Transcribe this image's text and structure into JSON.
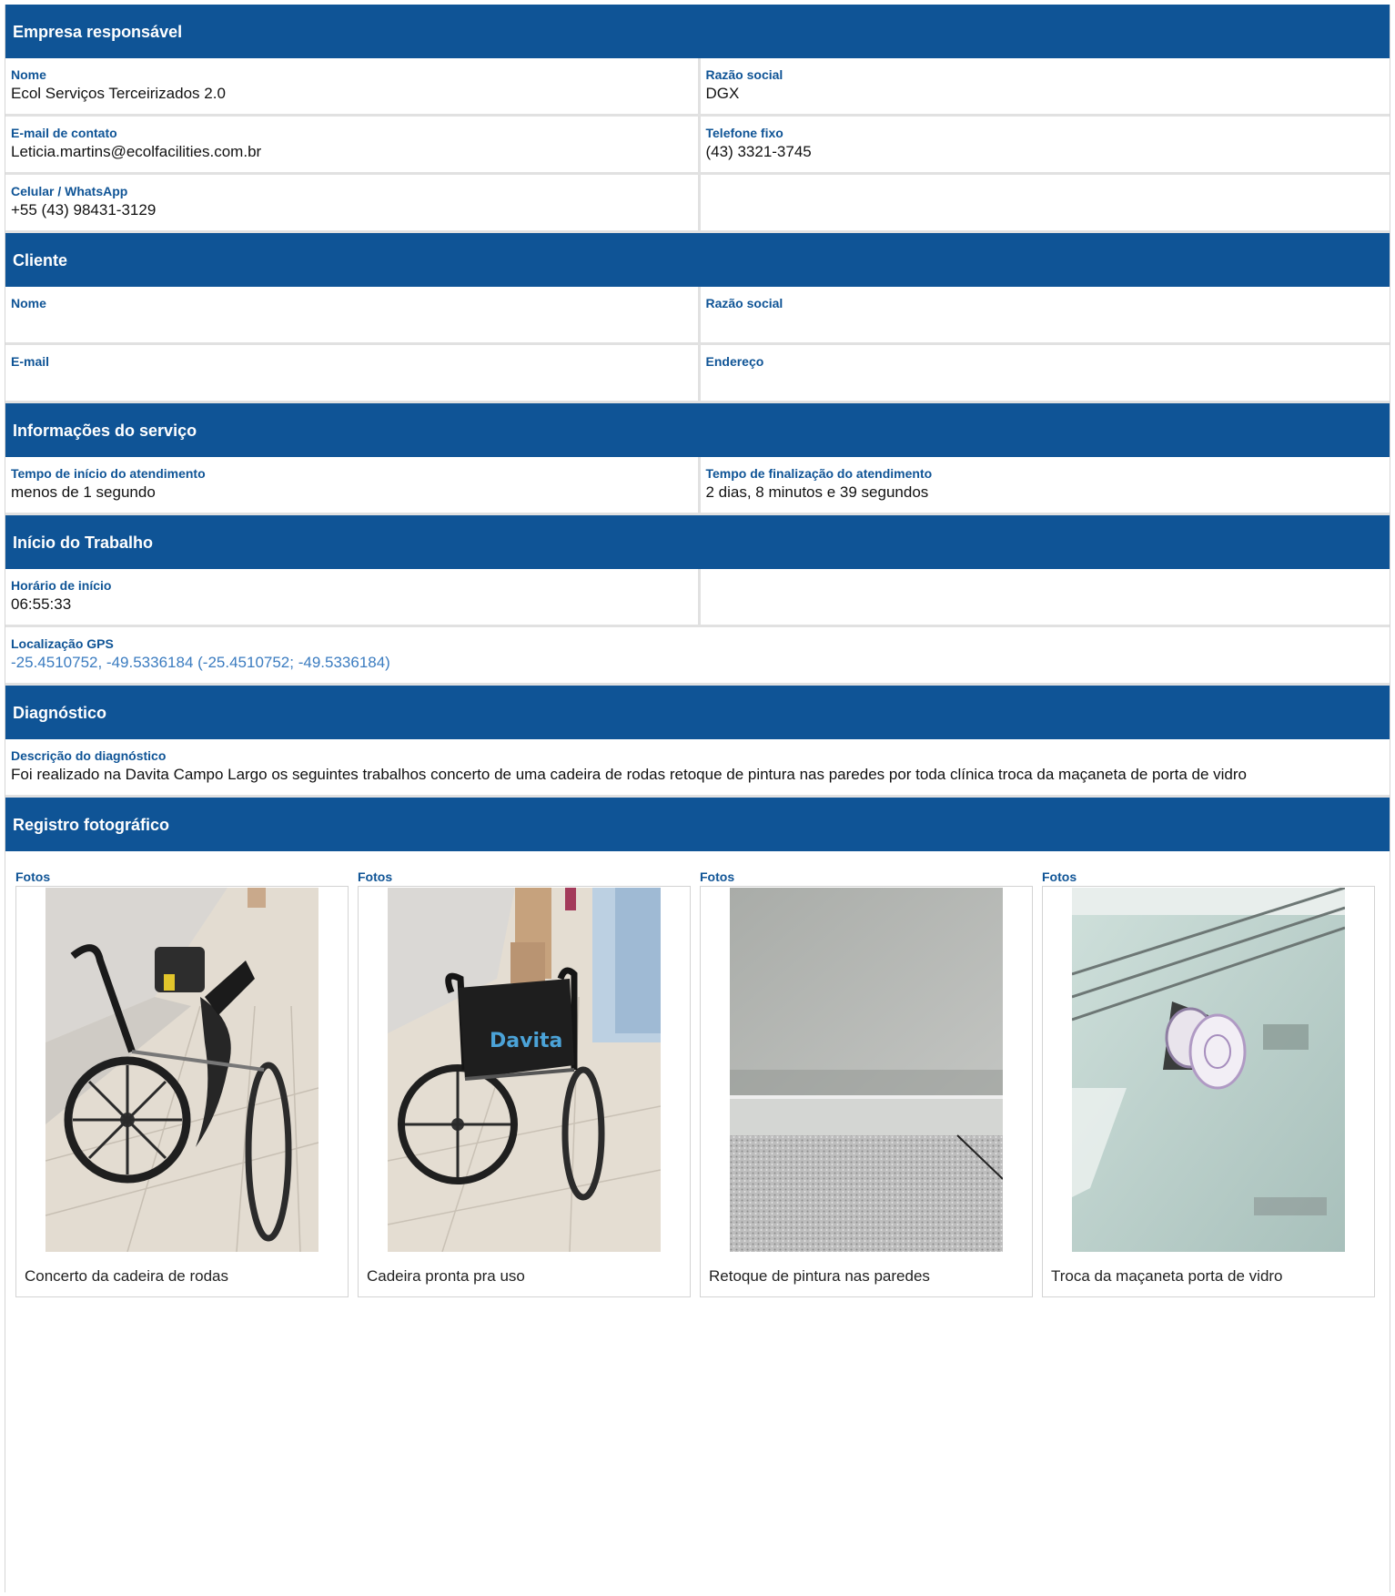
{
  "empresa": {
    "title": "Empresa responsável",
    "nome_label": "Nome",
    "nome": "Ecol Serviços Terceirizados 2.0",
    "razao_label": "Razão social",
    "razao": "DGX",
    "email_label": "E-mail de contato",
    "email": "Leticia.martins@ecolfacilities.com.br",
    "telefone_label": "Telefone fixo",
    "telefone": "(43) 3321-3745",
    "celular_label": "Celular / WhatsApp",
    "celular": "+55 (43) 98431-3129"
  },
  "cliente": {
    "title": "Cliente",
    "nome_label": "Nome",
    "nome": "",
    "razao_label": "Razão social",
    "razao": "",
    "email_label": "E-mail",
    "email": "",
    "endereco_label": "Endereço",
    "endereco": ""
  },
  "servico": {
    "title": "Informações do serviço",
    "inicio_label": "Tempo de início do atendimento",
    "inicio": "menos de 1 segundo",
    "fim_label": "Tempo de finalização do atendimento",
    "fim": "2 dias, 8 minutos e 39 segundos"
  },
  "trabalho": {
    "title": "Início do Trabalho",
    "horario_label": "Horário de início",
    "horario": "06:55:33",
    "gps_label": "Localização GPS",
    "gps": "-25.4510752, -49.5336184 (-25.4510752; -49.5336184)"
  },
  "diagnostico": {
    "title": "Diagnóstico",
    "descricao_label": "Descrição do diagnóstico",
    "descricao": "Foi realizado na Davita Campo Largo os seguintes trabalhos concerto de uma cadeira de rodas retoque de pintura nas paredes por toda clínica troca da maçaneta de porta de vidro"
  },
  "registro": {
    "title": "Registro fotográfico",
    "photos": [
      {
        "label": "Fotos",
        "caption": "Concerto da cadeira de rodas"
      },
      {
        "label": "Fotos",
        "caption": "Cadeira pronta pra uso"
      },
      {
        "label": "Fotos",
        "caption": "Retoque de pintura nas paredes"
      },
      {
        "label": "Fotos",
        "caption": "Troca da maçaneta porta de vidro"
      }
    ],
    "logo_text": "Davita"
  },
  "colors": {
    "header": "#0f5496",
    "label": "#0f5496",
    "link": "#3b7cc0"
  }
}
